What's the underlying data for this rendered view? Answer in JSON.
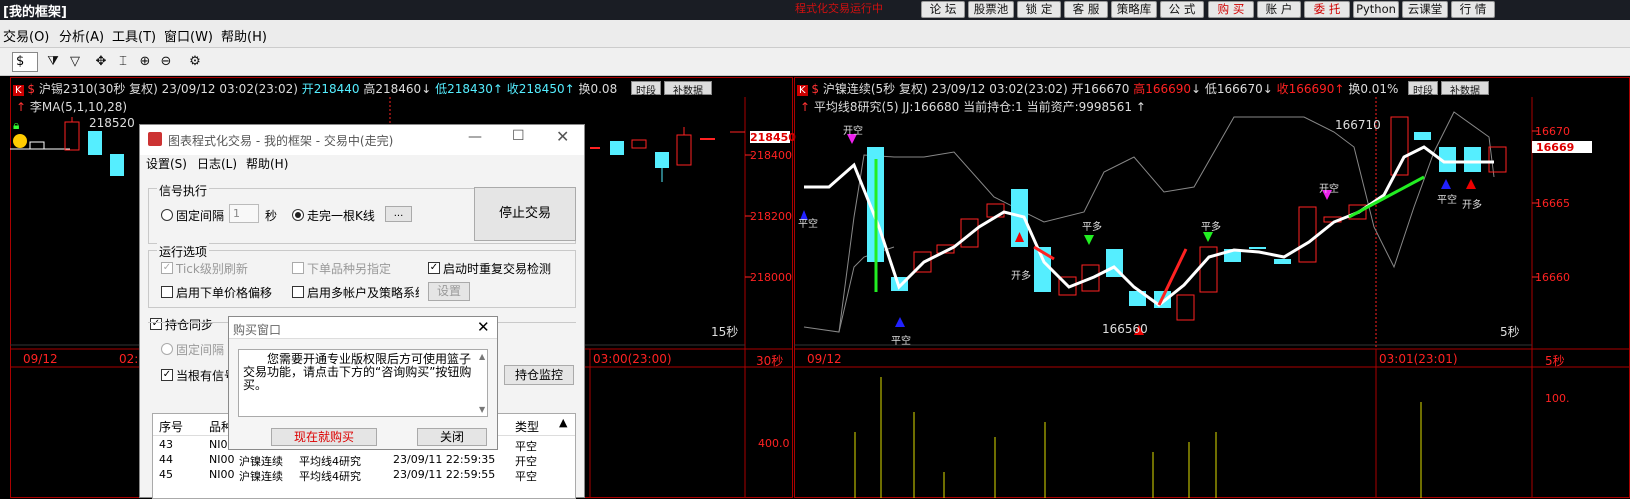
{
  "titlebar": {
    "title": "[我的框架]",
    "warning": "程式化交易运行中",
    "buttons": [
      "论 坛",
      "股票池",
      "锁 定",
      "客 服",
      "策略库",
      "公 式",
      "购 买",
      "账 户",
      "委 托",
      "Python",
      "云课堂",
      "行 情"
    ]
  },
  "menu": [
    "交易(O)",
    "分析(A)",
    "工具(T)",
    "窗口(W)",
    "帮助(H)"
  ],
  "toolbar": {
    "currency": "$",
    "icons": [
      "funnel-icon",
      "move-icon",
      "cursor-icon",
      "zoom-in-icon",
      "zoom-out-icon",
      "gear-icon"
    ]
  },
  "left_chart": {
    "symbol": "沪锡2310(30秒 复权) 23/09/12 03:02(23:02)",
    "open": "开218440",
    "high": "高218460",
    "low": "低218430",
    "close": "收218450",
    "turnover": "换0.08",
    "indicator": "李MA(5,1,10,28)",
    "hi_label": "218520",
    "price_tag": "218450",
    "y_labels": [
      "218400",
      "218200",
      "218000"
    ],
    "period": "15秒",
    "x_left": "09/12",
    "x_mid1": "02:",
    "x_mid2": "03:00(23:00)",
    "x_right": "30秒",
    "vol_label": "400.0",
    "btn_period": "时段",
    "btn_data": "补数据"
  },
  "right_chart": {
    "symbol": "沪镍连续(5秒 复权) 23/09/12 03:02(23:02)",
    "open": "开166670",
    "high": "高166690",
    "low": "低166670",
    "close": "收166690",
    "turnover": "换0.01%",
    "indicator": "平均线8研究(5) JJ:166680 当前持仓:1 当前资产:9998561",
    "label_high": "166710",
    "label_low": "166560",
    "y_labels": [
      "16670",
      "16669",
      "16665",
      "16660"
    ],
    "period": "5秒",
    "x_left": "09/12",
    "x_mid": "03:01(23:01)",
    "x_right": "5秒",
    "vol_label": "100.",
    "btn_period": "时段",
    "btn_data": "补数据",
    "signals": [
      "开空",
      "平空",
      "开多",
      "平多"
    ]
  },
  "main_dialog": {
    "title": "图表程式化交易 - 我的框架 - 交易中(走完)",
    "menu": [
      "设置(S)",
      "日志(L)",
      "帮助(H)"
    ],
    "group_signal": "信号执行",
    "fixed_interval": "固定间隔",
    "interval_value": "1",
    "seconds": "秒",
    "bar_complete": "走完一根K线",
    "ellipsis": "...",
    "stop_button": "停止交易",
    "group_options": "运行选项",
    "tick_refresh": "Tick级别刷新",
    "other_symbol": "下单品种另指定",
    "restart_check": "启动时重复交易检测",
    "price_offset": "启用下单价格偏移",
    "multi_account": "启用多帐户及策略系统",
    "setup": "设置",
    "sync_position": "持仓同步",
    "fixed_interval2": "固定间隔",
    "signal_when": "当根有信号",
    "monitor_button": "持仓监控",
    "table_headers": [
      "序号",
      "品种",
      "类型"
    ],
    "rows": [
      {
        "no": "43",
        "code": "NI00",
        "name": "",
        "strategy": "",
        "time": "",
        "type": "平空"
      },
      {
        "no": "44",
        "code": "NI00",
        "name": "沪镍连续",
        "strategy": "平均线4研究",
        "time": "23/09/11 22:59:35",
        "type": "开空"
      },
      {
        "no": "45",
        "code": "NI00",
        "name": "沪镍连续",
        "strategy": "平均线4研究",
        "time": "23/09/11 22:59:55",
        "type": "平空"
      }
    ]
  },
  "buy_dialog": {
    "title": "购买窗口",
    "message": "您需要开通专业版权限后方可使用篮子交易功能，请点击下方的“咨询购买”按钮购买。",
    "buy_now": "现在就购买",
    "close": "关闭"
  }
}
